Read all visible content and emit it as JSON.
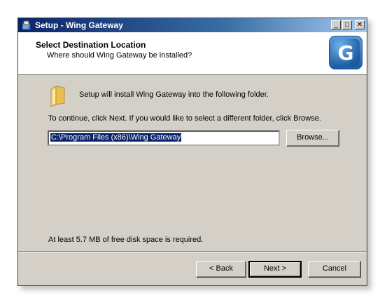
{
  "window": {
    "title": "Setup - Wing Gateway",
    "controls": {
      "minimize": "_",
      "maximize": "□",
      "close": "✕"
    }
  },
  "header": {
    "title": "Select Destination Location",
    "subtitle": "Where should Wing Gateway be installed?",
    "logo_letter": "G"
  },
  "body": {
    "install_text": "Setup will install Wing Gateway into the following folder.",
    "instruction_text": "To continue, click Next. If you would like to select a different folder, click Browse.",
    "path_value": "C:\\Program Files (x86)\\Wing Gateway",
    "browse_label": "Browse...",
    "disk_space_text": "At least 5.7 MB of free disk space is required."
  },
  "footer": {
    "back_label": "< Back",
    "next_label": "Next >",
    "cancel_label": "Cancel"
  },
  "icons": [
    "setup-icon",
    "wing-logo-icon",
    "folder-icon"
  ],
  "colors": {
    "title_bar": "#0a246a",
    "selection": "#0a246a",
    "logo": "#1f5fa8"
  }
}
